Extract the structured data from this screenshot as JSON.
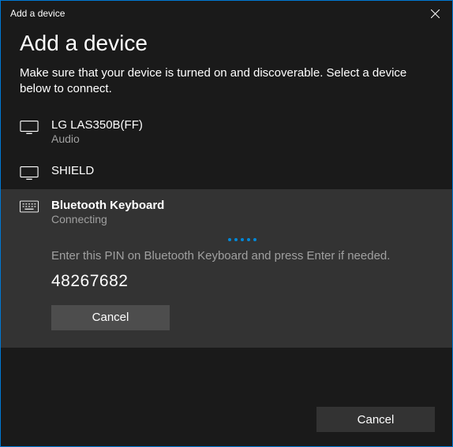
{
  "titlebar": {
    "title": "Add a device"
  },
  "header": {
    "heading": "Add a device",
    "subheading": "Make sure that your device is turned on and discoverable. Select a device below to connect."
  },
  "devices": [
    {
      "name": "LG LAS350B(FF)",
      "subtext": "Audio",
      "icon": "display-icon",
      "selected": false
    },
    {
      "name": "SHIELD",
      "subtext": "",
      "icon": "display-icon",
      "selected": false
    },
    {
      "name": "Bluetooth  Keyboard",
      "subtext": "Connecting",
      "icon": "keyboard-icon",
      "selected": true,
      "pairing": {
        "instruction": "Enter this PIN on Bluetooth  Keyboard and press Enter if needed.",
        "pin": "48267682",
        "cancel_label": "Cancel"
      }
    }
  ],
  "footer": {
    "cancel_label": "Cancel"
  }
}
